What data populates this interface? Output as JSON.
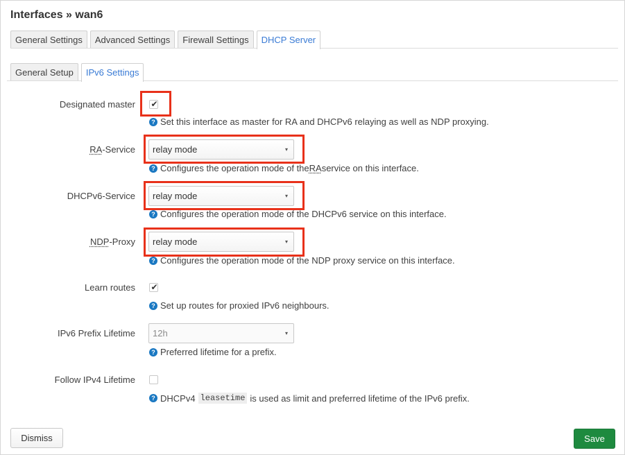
{
  "header": {
    "title": "Interfaces » wan6"
  },
  "tabs_primary": [
    {
      "label": "General Settings",
      "active": false
    },
    {
      "label": "Advanced Settings",
      "active": false
    },
    {
      "label": "Firewall Settings",
      "active": false
    },
    {
      "label": "DHCP Server",
      "active": true
    }
  ],
  "tabs_secondary": [
    {
      "label": "General Setup",
      "active": false
    },
    {
      "label": "IPv6 Settings",
      "active": true
    }
  ],
  "form": {
    "designated_master": {
      "label": "Designated master",
      "checked": true,
      "help": "Set this interface as master for RA and DHCPv6 relaying as well as NDP proxying."
    },
    "ra_service": {
      "label_abbr": "RA",
      "label_rest": "-Service",
      "value": "relay mode",
      "help_pre": "Configures the operation mode of the ",
      "help_abbr": "RA",
      "help_post": " service on this interface."
    },
    "dhcpv6_service": {
      "label": "DHCPv6-Service",
      "value": "relay mode",
      "help": "Configures the operation mode of the DHCPv6 service on this interface."
    },
    "ndp_proxy": {
      "label_abbr": "NDP",
      "label_rest": "-Proxy",
      "value": "relay mode",
      "help": "Configures the operation mode of the NDP proxy service on this interface."
    },
    "learn_routes": {
      "label": "Learn routes",
      "checked": true,
      "help": "Set up routes for proxied IPv6 neighbours."
    },
    "prefix_lifetime": {
      "label": "IPv6 Prefix Lifetime",
      "value": "12h",
      "help": "Preferred lifetime for a prefix."
    },
    "follow_ipv4": {
      "label": "Follow IPv4 Lifetime",
      "checked": false,
      "help_pre": "DHCPv4",
      "help_code": "leasetime",
      "help_post": "is used as limit and preferred lifetime of the IPv6 prefix."
    }
  },
  "icons": {
    "help": "help-circle-icon",
    "check": "checkmark-icon",
    "caret": "caret-down-icon"
  },
  "check_glyph": "✔",
  "help_glyph": "?",
  "caret_glyph": "▾",
  "footer": {
    "dismiss_label": "Dismiss",
    "save_label": "Save"
  },
  "colors": {
    "accent": "#3a7bd5",
    "highlight": "#e8311a",
    "save": "#1e8a3f",
    "help_icon": "#1a78c2"
  }
}
